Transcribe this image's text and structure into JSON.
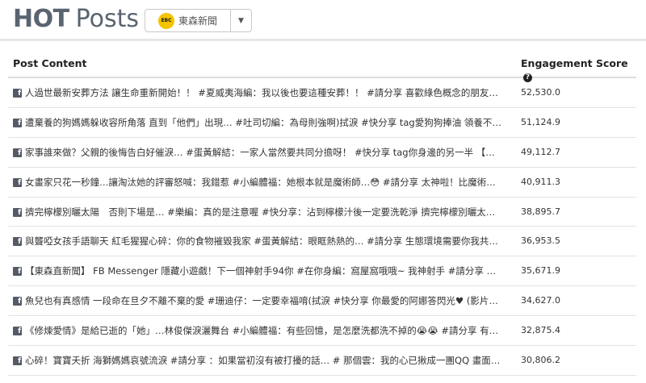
{
  "header": {
    "title_hot": "HOT",
    "title_posts": "Posts",
    "page_selector": {
      "logo_text": "EBC",
      "name": "東森新聞",
      "caret": "▼"
    }
  },
  "table": {
    "columns": {
      "content": "Post Content",
      "score": "Engagement Score",
      "help": "?"
    },
    "rows": [
      {
        "text": "人過世最新安葬方法 讓生命重新開始！！ #夏威夷海編：我以後也要這種安葬！！ #請分享 喜歡綠色概念的朋友~…",
        "score": "52,530.0"
      },
      {
        "text": "遭棄養的狗媽媽躲收容所角落 直到「他們」出現… #吐司切編：為母則強啊)拭淚 #快分享 tag愛狗狗捧油 領養不棄…",
        "score": "51,124.9"
      },
      {
        "text": "家事誰來做？父親的後悔告白好催淚… #蛋黃解結：一家人當然要共同分擔呀！ #快分享 tag你身邊的另一半 【我要…",
        "score": "49,112.7"
      },
      {
        "text": "女畫家只花一秒鐘…讓淘汰她的評審怒喊：我錯惹 #小編體福：她根本就是魔術師…😳 #請分享 太神啦！比魔術還…",
        "score": "40,911.3"
      },
      {
        "text": "擠完檸檬別曬太陽　否則下場是… #樂編：真的是注意喔 #快分享：沾到檸檬汁後一定要洗乾淨 擠完檸檬別曬太陽…",
        "score": "38,895.7"
      },
      {
        "text": "與聾啞女孩手語聊天 紅毛猩猩心碎：你的食物摧毀我家 #蛋黃解結：眼眶熱熱的… #請分享 生態環境需要你我共同…",
        "score": "36,953.5"
      },
      {
        "text": "【東森直新聞】 FB Messenger 隱藏小遊戲！下一個神射手94你 #在你身編：窩屋窩哦哦~ 我神射手 #請分享 快ta…",
        "score": "35,671.9"
      },
      {
        "text": "魚兒也有真感情 一段命在旦夕不離不棄的愛 #珊迪仔：一定要幸福唷(拭淚 #快分享 你最愛的阿娜答閃光♥ (影片來…",
        "score": "34,627.0"
      },
      {
        "text": "《修煉愛情》是給已逝的「她」…林俊傑淚灑舞台 #小編體福：有些回憶，是怎麼洗都洗不掉的😭😭 #請分享 有什…",
        "score": "32,875.4"
      },
      {
        "text": "心碎！寶寶夭折 海獅媽媽哀號流淚 #請分享 ：如果當初沒有被打擾的話… # 那個雲：我的心已揪成一團QQ 畫面來…",
        "score": "30,806.2"
      }
    ]
  }
}
